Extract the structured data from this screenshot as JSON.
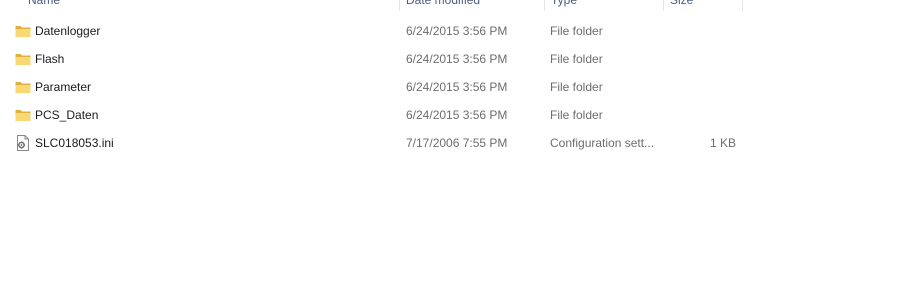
{
  "columns": {
    "name": "Name",
    "date_modified": "Date modified",
    "type": "Type",
    "size": "Size"
  },
  "rows": [
    {
      "name": "Datenlogger",
      "date": "6/24/2015 3:56 PM",
      "type": "File folder",
      "size": "",
      "icon": "folder-icon"
    },
    {
      "name": "Flash",
      "date": "6/24/2015 3:56 PM",
      "type": "File folder",
      "size": "",
      "icon": "folder-icon"
    },
    {
      "name": "Parameter",
      "date": "6/24/2015 3:56 PM",
      "type": "File folder",
      "size": "",
      "icon": "folder-icon"
    },
    {
      "name": "PCS_Daten",
      "date": "6/24/2015 3:56 PM",
      "type": "File folder",
      "size": "",
      "icon": "folder-icon"
    },
    {
      "name": "SLC018053.ini",
      "date": "7/17/2006 7:55 PM",
      "type": "Configuration sett...",
      "size": "1 KB",
      "icon": "settings-file-icon"
    }
  ],
  "colors": {
    "folder": "#f8d775",
    "folder_dark": "#e0b03c",
    "header_text": "#4d6082",
    "secondary_text": "#6d6d6d"
  }
}
